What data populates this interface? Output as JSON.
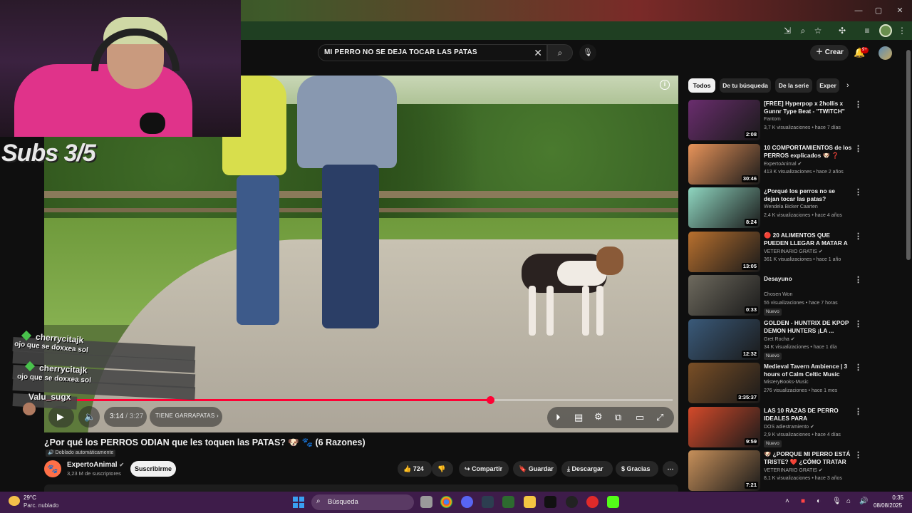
{
  "browser": {
    "window_buttons": [
      "—",
      "▢",
      "✕"
    ],
    "toolbar_icons": [
      "install-icon",
      "zoom-icon",
      "star-icon",
      "extensions-icon",
      "media-icon",
      "profile-avatar",
      "menu-icon"
    ]
  },
  "youtube_header": {
    "search_value": "MI PERRO NO SE DEJA TOCAR LAS PATAS",
    "create_label": "Crear",
    "notifications_badge": "9+"
  },
  "stream_overlay": {
    "subs_text": "Subs 3/5",
    "chat": [
      {
        "user": "cherrycitajk",
        "message": "ojo que se doxxea sol"
      },
      {
        "user": "cherrycitajk",
        "message": "ojo que se doxxea sol"
      },
      {
        "user": "Valu_sugx",
        "message": ""
      }
    ]
  },
  "player": {
    "current_time": "3:14",
    "total_time": "/ 3:27",
    "chapter": "TIENE GARRAPATAS",
    "progress_fraction": 0.71
  },
  "video": {
    "title": "¿Por qué los PERROS ODIAN que les toquen las PATAS? 🐶 🐾 (6 Razones)",
    "dub_badge": "Doblado automáticamente",
    "channel_name": "ExpertoAnimal",
    "channel_subs": "3,23 M de suscriptores",
    "subscribe_label": "Suscribirme",
    "likes": "724",
    "share_label": "Compartir",
    "save_label": "Guardar",
    "download_label": "Descargar",
    "thanks_label": "Gracias"
  },
  "sidebar": {
    "chips": [
      "Todos",
      "De tu búsqueda",
      "De la serie",
      "Exper"
    ],
    "recommendations": [
      {
        "title": "[FREE] Hyperpop x 2hollis x Gunnr Type Beat - \"TWITCH\"",
        "channel": "Fantom",
        "meta": "3,7 K visualizaciones • hace 7 días",
        "duration": "2:08",
        "new": "",
        "thumb_color": "#6a2d6e"
      },
      {
        "title": "10 COMPORTAMIENTOS de los PERROS explicados 🐶 ❓",
        "channel": "ExpertoAnimal ✔",
        "meta": "413 K visualizaciones • hace 2 años",
        "duration": "30:46",
        "new": "",
        "thumb_color": "#e8945a"
      },
      {
        "title": "¿Porqué los perros no se dejan tocar las patas?",
        "channel": "Wendela Bicker Caarten",
        "meta": "2,4 K visualizaciones • hace 4 años",
        "duration": "8:24",
        "new": "",
        "thumb_color": "#8fd6c0"
      },
      {
        "title": "🔴 20 ALIMENTOS QUE PUEDEN LLEGAR A MATAR A ...",
        "channel": "VETERINARIO GRATIS ✔",
        "meta": "361 K visualizaciones • hace 1 año",
        "duration": "13:05",
        "new": "",
        "thumb_color": "#b8702e"
      },
      {
        "title": "Desayuno",
        "channel": "Chosen Won",
        "meta": "55 visualizaciones • hace 7 horas",
        "duration": "0:33",
        "new": "Nuevo",
        "thumb_color": "#6e6a5e"
      },
      {
        "title": "GOLDEN - HUNTRIX DE KPOP DEMON HUNTERS ¡LA ...",
        "channel": "Gret Rocha ✔",
        "meta": "34 K visualizaciones • hace 1 día",
        "duration": "12:32",
        "new": "Nuevo",
        "thumb_color": "#3a5a7a"
      },
      {
        "title": "Medieval Tavern Ambience | 3 hours of Calm Celtic Music for...",
        "channel": "MisteryBooks-Music",
        "meta": "276 visualizaciones • hace 1 mes",
        "duration": "3:35:37",
        "new": "",
        "thumb_color": "#7a4f26"
      },
      {
        "title": "LAS 10 RAZAS DE PERRO IDEALES PARA APARTAMENT...",
        "channel": "DOS adiestramiento ✔",
        "meta": "2,9 K visualizaciones • hace 4 días",
        "duration": "9:59",
        "new": "Nuevo",
        "thumb_color": "#d44a2a"
      },
      {
        "title": "🐶 ¿PORQUE MI PERRO ESTÁ TRISTE? ❤️ ¿CÓMO TRATAR L...",
        "channel": "VETERINARIO GRATIS ✔",
        "meta": "8,1 K visualizaciones • hace 3 años",
        "duration": "7:21",
        "new": "",
        "thumb_color": "#c7905a"
      }
    ]
  },
  "taskbar": {
    "temperature": "29°C",
    "weather": "Parc. nublado",
    "search_placeholder": "Búsqueda",
    "time": "0:35",
    "date": "08/08/2025"
  }
}
